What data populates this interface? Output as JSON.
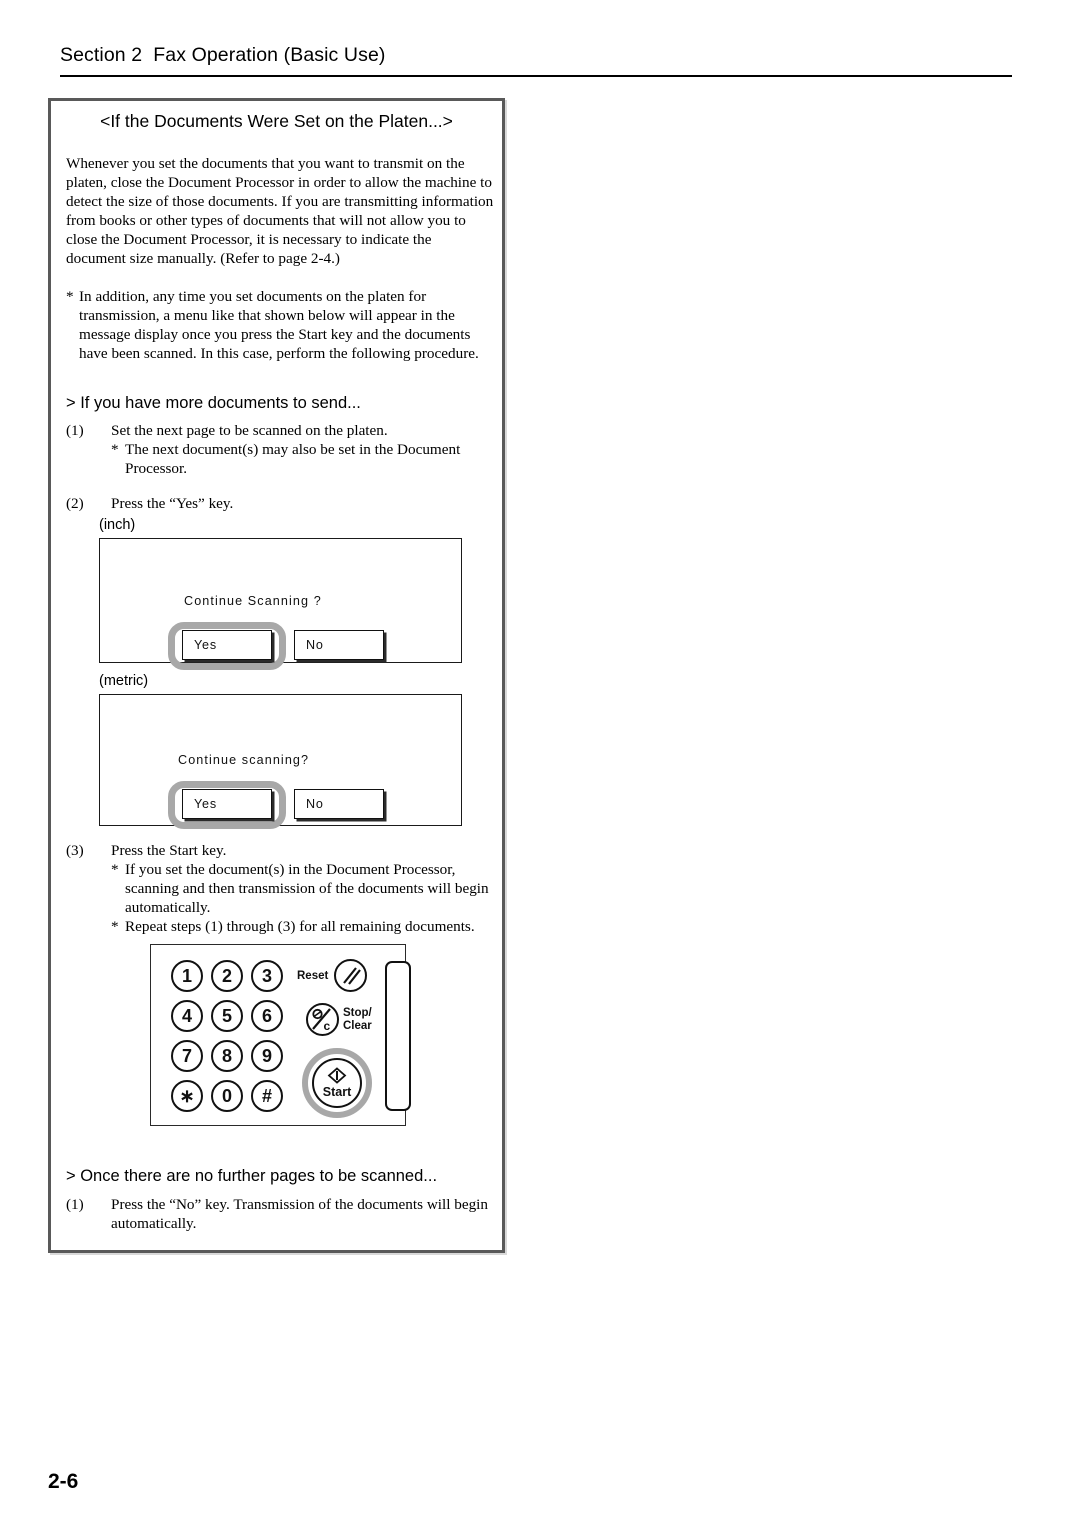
{
  "header": {
    "title": "Section 2  Fax Operation (Basic Use)"
  },
  "callout": {
    "title": "<If the Documents Were Set on the Platen...>",
    "intro_paragraph": "Whenever you set the documents that you want to transmit on the platen, close the Document Processor in order to allow the machine to detect the size of those documents. If you are transmitting information from books or other types of documents that will not allow you to close the Document Processor, it is necessary to indicate the document size manually. (Refer to page 2-4.)",
    "intro_note_mark": "*",
    "intro_note": "In addition, any time you set documents on the platen for transmission, a menu like that shown below will appear in the message display once you press the Start key and the documents have been scanned. In this case, perform the following procedure."
  },
  "section_more_docs": {
    "heading": "> If you have more documents to send...",
    "steps": [
      {
        "num": "(1)",
        "text": "Set the next page to be scanned on the platen.",
        "note_mark": "*",
        "note": "The next document(s) may also be set in the Document Processor."
      },
      {
        "num": "(2)",
        "text": "Press the “Yes” key."
      },
      {
        "num": "(3)",
        "text": "Press the Start key.",
        "note_mark": "*",
        "note": "If you set the document(s) in the Document Processor, scanning and then transmission of the documents will begin automatically.",
        "note2_mark": "*",
        "note2": "Repeat steps (1) through (3) for all remaining documents."
      }
    ]
  },
  "display_inch": {
    "unit_label": "(inch)",
    "message": "Continue Scanning ?",
    "yes_label": "Yes",
    "no_label": "No",
    "selected": "Yes"
  },
  "display_metric": {
    "unit_label": "(metric)",
    "message": "Continue scanning?",
    "yes_label": "Yes",
    "no_label": "No",
    "selected": "Yes"
  },
  "keypad": {
    "keys": [
      "1",
      "2",
      "3",
      "4",
      "5",
      "6",
      "7",
      "8",
      "9",
      "∗",
      "0",
      "#"
    ],
    "reset_label": "Reset",
    "stop_clear_label": "Stop/\nClear",
    "start_label": "Start",
    "highlighted_key": "Start"
  },
  "section_no_further": {
    "heading": "> Once there are no further pages to be scanned...",
    "steps": [
      {
        "num": "(1)",
        "text": "Press the “No” key. Transmission of the documents will begin automatically."
      }
    ]
  },
  "folio": {
    "page_number": "2-6"
  },
  "colors": {
    "frame_border": "#595959",
    "highlight_ring": "#a8a8a8",
    "text": "#000000",
    "panel_border": "#1a1a1a"
  }
}
